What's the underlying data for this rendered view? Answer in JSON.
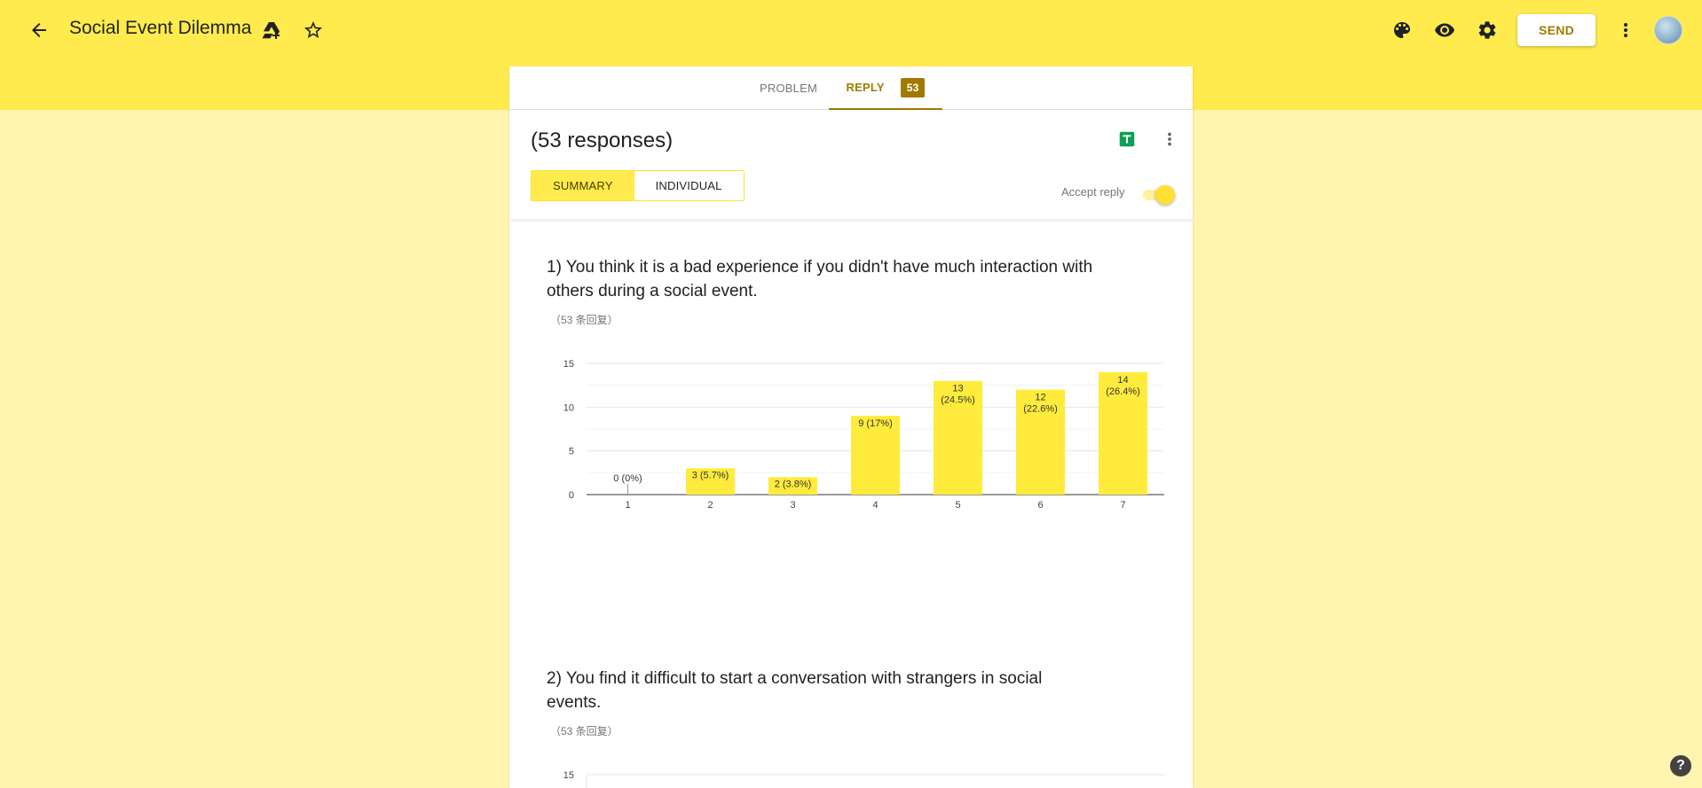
{
  "app": {
    "title": "Social Event Dilemma"
  },
  "toolbar": {
    "send_label": "SEND"
  },
  "tabs": {
    "problem": "PROBLEM",
    "reply": "REPLY",
    "reply_count": "53"
  },
  "responses": {
    "title": "(53 responses)",
    "summary_label": "SUMMARY",
    "individual_label": "INDIVIDUAL",
    "accept_label": "Accept reply",
    "accepting": true
  },
  "questions": [
    {
      "text": "1) You think it is a bad experience if you didn't have much interaction with others during a social event.",
      "count_label": "（53 条回复）"
    },
    {
      "text": "2) You find it difficult to start a conversation with strangers in social events.",
      "count_label": "（53 条回复）"
    }
  ],
  "chart_data": [
    {
      "type": "bar",
      "categories": [
        "1",
        "2",
        "3",
        "4",
        "5",
        "6",
        "7"
      ],
      "values": [
        0,
        3,
        2,
        9,
        13,
        12,
        14
      ],
      "data_labels": [
        [
          "0 (0%)"
        ],
        [
          "3 (5.7%)"
        ],
        [
          "2 (3.8%)"
        ],
        [
          "9 (17%)"
        ],
        [
          "13",
          "(24.5%)"
        ],
        [
          "12",
          "(22.6%)"
        ],
        [
          "14",
          "(26.4%)"
        ]
      ],
      "yticks": [
        0,
        5,
        10,
        15
      ],
      "ylim": [
        0,
        15
      ],
      "bar_color": "#ffeb3b",
      "grid": true
    },
    {
      "type": "bar",
      "yticks": [
        15
      ],
      "ylim": [
        0,
        15
      ],
      "partially_visible": true
    }
  ],
  "colors": {
    "accent": "#ffeb4d",
    "background": "#fff4b0",
    "brand_text": "#a17a00"
  }
}
